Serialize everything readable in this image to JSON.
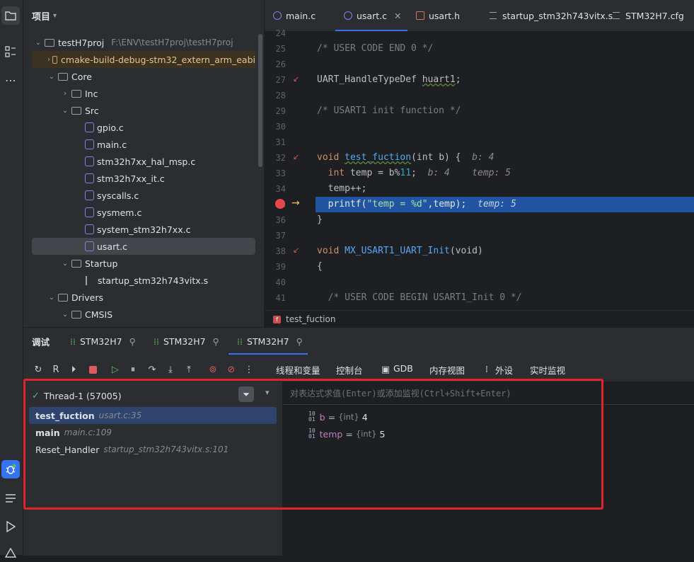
{
  "project": {
    "title": "项目",
    "tree": [
      {
        "label": "testH7proj",
        "hint": "F:\\ENV\\testH7proj\\testH7proj",
        "kind": "folder",
        "expanded": true,
        "depth": 0
      },
      {
        "label": "cmake-build-debug-stm32_extern_arm_eabi",
        "kind": "folder",
        "expanded": false,
        "depth": 1
      },
      {
        "label": "Core",
        "kind": "folder",
        "expanded": true,
        "depth": 1
      },
      {
        "label": "Inc",
        "kind": "folder",
        "expanded": false,
        "depth": 2
      },
      {
        "label": "Src",
        "kind": "folder",
        "expanded": true,
        "depth": 2
      },
      {
        "label": "gpio.c",
        "kind": "c",
        "depth": 3
      },
      {
        "label": "main.c",
        "kind": "c",
        "depth": 3
      },
      {
        "label": "stm32h7xx_hal_msp.c",
        "kind": "c",
        "depth": 3
      },
      {
        "label": "stm32h7xx_it.c",
        "kind": "c",
        "depth": 3
      },
      {
        "label": "syscalls.c",
        "kind": "c",
        "depth": 3
      },
      {
        "label": "sysmem.c",
        "kind": "c",
        "depth": 3
      },
      {
        "label": "system_stm32h7xx.c",
        "kind": "c",
        "depth": 3
      },
      {
        "label": "usart.c",
        "kind": "c",
        "depth": 3,
        "selected": true
      },
      {
        "label": "Startup",
        "kind": "folder",
        "expanded": true,
        "depth": 2
      },
      {
        "label": "startup_stm32h743vitx.s",
        "kind": "s",
        "depth": 3
      },
      {
        "label": "Drivers",
        "kind": "folder",
        "expanded": true,
        "depth": 1
      },
      {
        "label": "CMSIS",
        "kind": "folder",
        "expanded": true,
        "depth": 2
      }
    ]
  },
  "editor": {
    "tabs": [
      "main.c",
      "usart.c",
      "usart.h",
      "startup_stm32h743vitx.s",
      "STM32H7.cfg"
    ],
    "active_tab": "usart.c",
    "line_numbers": [
      "24",
      "25",
      "26",
      "27",
      "28",
      "29",
      "30",
      "31",
      "32",
      "33",
      "34",
      "35",
      "36",
      "37",
      "38",
      "39",
      "40",
      "41"
    ],
    "lines": {
      "l25": "/* USER CODE END 0 */",
      "l27_type": "UART_HandleTypeDef",
      "l27_var": "huart1",
      "l29": "/* USART1 init function */",
      "l32_kw": "void",
      "l32_fn": "test_fuction",
      "l32_args": "(int b) {",
      "l32_hint": "b: 4",
      "l33_kw": "int",
      "l33_body": " temp = b%",
      "l33_num": "11",
      "l33_end": ";",
      "l33_hint1": "b: 4",
      "l33_hint2": "temp: 5",
      "l34": "temp++;",
      "l35_fn": "printf",
      "l35_str": "\"temp = %d\"",
      "l35_end": ",temp);",
      "l35_hint": "temp: 5",
      "l36": "}",
      "l38_kw": "void",
      "l38_fn": "MX_USART1_UART_Init",
      "l38_args": "(void)",
      "l39": "{",
      "l41": "/* USER CODE BEGIN USART1_Init 0 */"
    },
    "breadcrumb": "test_fuction"
  },
  "debug": {
    "title": "调试",
    "sessions": [
      "STM32H7",
      "STM32H7",
      "STM32H7"
    ],
    "toolbar_tabs": [
      "线程和变量",
      "控制台",
      "GDB",
      "内存视图",
      "外设",
      "实时监视"
    ],
    "thread": "Thread-1 (57005)",
    "frames": [
      {
        "name": "test_fuction",
        "loc": "usart.c:35",
        "selected": true
      },
      {
        "name": "main",
        "loc": "main.c:109"
      },
      {
        "name": "Reset_Handler",
        "loc": "startup_stm32h743vitx.s:101"
      }
    ],
    "watch_placeholder": "对表达式求值(Enter)或添加监视(Ctrl+Shift+Enter)",
    "variables": [
      {
        "name": "b",
        "type": "{int}",
        "value": "4"
      },
      {
        "name": "temp",
        "type": "{int}",
        "value": "5"
      }
    ]
  },
  "colors": {
    "accent": "#3574f0",
    "highlight_box": "#e0252f",
    "exec_line": "#2154a3"
  }
}
